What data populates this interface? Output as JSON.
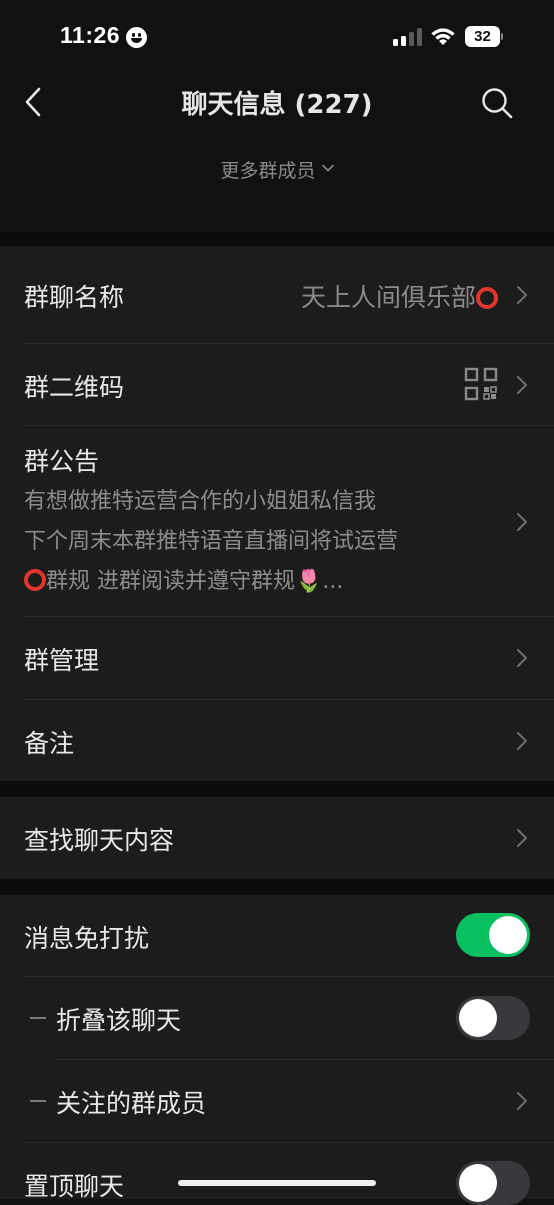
{
  "status_bar": {
    "time": "11:26",
    "battery": "32"
  },
  "nav": {
    "title": "聊天信息 (227)"
  },
  "more_members": {
    "label": "更多群成员"
  },
  "group_name": {
    "label": "群聊名称",
    "value": "天上人间俱乐部"
  },
  "group_qr": {
    "label": "群二维码"
  },
  "announcement": {
    "label": "群公告",
    "lines": [
      "有想做推特运营合作的小姐姐私信我",
      "下个周末本群推特语音直播间将试运营",
      "群规 进群阅读并遵守群规🌷..."
    ]
  },
  "group_manage": {
    "label": "群管理"
  },
  "remark": {
    "label": "备注"
  },
  "search_chat": {
    "label": "查找聊天内容"
  },
  "mute": {
    "label": "消息免打扰",
    "on": true
  },
  "fold_chat": {
    "label": "折叠该聊天",
    "on": false
  },
  "followed_members": {
    "label": "关注的群成员"
  },
  "pin_chat": {
    "label": "置顶聊天",
    "on": false
  },
  "colors": {
    "accent_green": "#07c160",
    "section_bg": "#1c1c1c",
    "page_bg": "#111111",
    "red_circle": "#e1352e"
  }
}
